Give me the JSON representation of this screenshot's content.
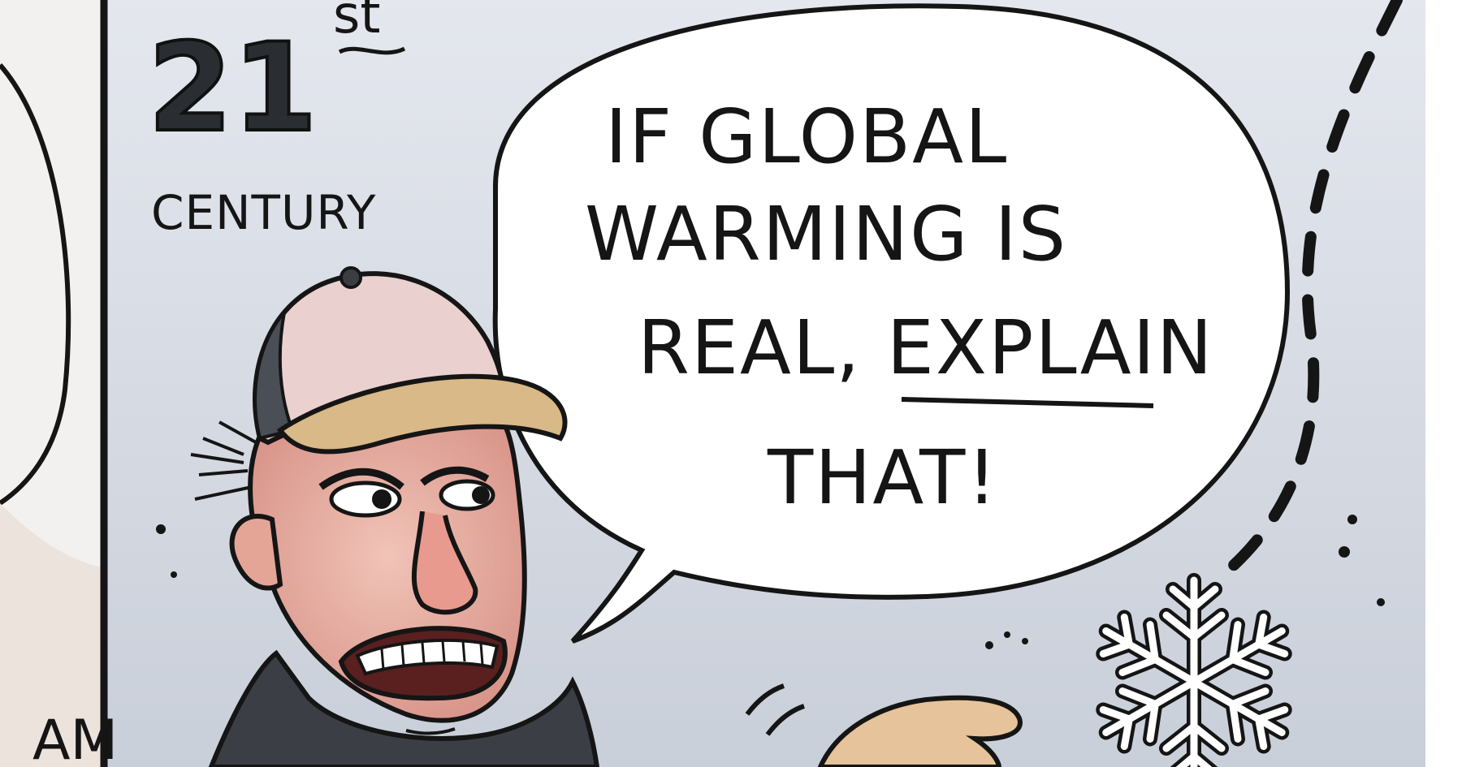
{
  "panel": {
    "caption_number": "21",
    "caption_suffix": "st",
    "caption_word": "CENTURY",
    "signature_fragment": "AM"
  },
  "speech_bubble": {
    "lines": [
      "IF GLOBAL",
      "WARMING IS",
      "REAL, EXPLAIN",
      "THAT!"
    ]
  },
  "colors": {
    "sky": "#d4d9e2",
    "outline": "#151515",
    "cap_crown": "#e8c7c7",
    "cap_brim": "#d8b987",
    "skin": "#e7b0a4",
    "bubble_fill": "#ffffff"
  },
  "icons": [
    "snowflake-icon"
  ]
}
